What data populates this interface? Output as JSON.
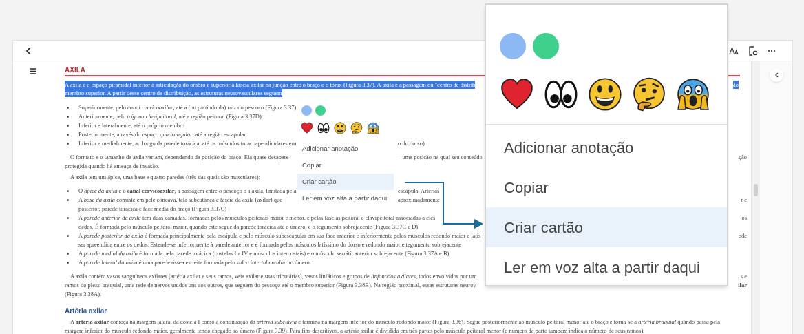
{
  "document": {
    "heading": "AXILA",
    "blocks": [
      {
        "kind": "highlight",
        "lines": [
          {
            "text": "A axila é o espaço piramidal inferior à articulação do ombro e superior à fáscia axilar na junção entre o braço e o tórax (Figura 3.37). A axila é a passagem ou \"centro de distrib",
            "edge": "ão"
          },
          {
            "text": "membro superior. A partir desse centro de distribuição, as estruturas neurovasculares seguem"
          }
        ]
      },
      {
        "kind": "bullets",
        "items": [
          {
            "lines": [
              {
                "text": "Superiormente, pelo *canal cervicoaxilar*, até a (ou partindo da) raiz do pescoço (Figura 3.37)"
              }
            ]
          },
          {
            "lines": [
              {
                "text": "Anteriormente, pelo *trígono clavipeitoral*, até a região peitoral (Figura 3.37D)"
              }
            ]
          },
          {
            "lines": [
              {
                "text": "Inferior e lateralmente, até o próprio membro"
              }
            ]
          },
          {
            "lines": [
              {
                "text": "Posteriormente, através do *espaço quadrangular*, até a região escapular"
              }
            ]
          },
          {
            "lines": [
              {
                "text": "Inferior e medialmente, ao longo da parede torácica, até os músculos toracoapendiculares em",
                "after_menu": "o do dorso)"
              }
            ]
          }
        ]
      },
      {
        "kind": "paragraph",
        "lines": [
          {
            "text": "O formato e o tamanho da axila variam, dependendo da posição do braço. Ela quase desapare",
            "after_menu": "– uma posição na qual seu conteúdo",
            "edge": "ção"
          },
          {
            "text": "protegida quando há ameaça de invasão."
          }
        ]
      },
      {
        "kind": "paragraph",
        "lines": [
          {
            "text": "A axila tem um ápice, uma base e quatro paredes (três das quais são musculares):"
          }
        ]
      },
      {
        "kind": "bullets",
        "items": [
          {
            "lines": [
              {
                "text": "O *ápice da axila* é o **canal cervicoaxilar**, a passagem entre o pescoço e a axila, limitada pela",
                "after_menu": "escápula. Artérias"
              }
            ]
          },
          {
            "lines": [
              {
                "text": "A *base da axila* consiste em pele côncava, tela subcutânea e fáscia da axila (axilar) que",
                "after_menu": "aproximadamente",
                "edge": "r e"
              },
              {
                "text": "posterior, parede torácica e face média do braço (Figura 3.37C)"
              }
            ]
          },
          {
            "lines": [
              {
                "text": "A *parede anterior da axila* tem duas camadas, formadas pelos músculos peitorais maior e menor, e pelas fáscias peitoral e clavipeitoral associadas a eles",
                "edge": "os"
              },
              {
                "text": "dedos. É formada pelo músculo peitoral maior, quando este segue da parede torácica até o úmero, e o tegumento sobrejacente (Figura 3.37C e D)"
              }
            ]
          },
          {
            "lines": [
              {
                "text": "A *parede posterior da axila* é formada principalmente pela escápula e pelo músculo subescapular em sua face anterior e inferiormente pelos músculos redondo maior e latís",
                "edge": "ode"
              },
              {
                "text": "ser apreendida entre os dedos. Estende-se inferiormente à parede anterior e é formada pelos músculos latíssimo do dorso e redondo maior e tegumento sobrejacente"
              }
            ]
          },
          {
            "lines": [
              {
                "text": "A *parede medial da axila* é formada pela parede torácica (costelas I a IV e músculos intercostais) e o músculo serrátil anterior sobrejacente (Figura 3.37A e B)"
              }
            ]
          },
          {
            "lines": [
              {
                "text": "A *parede lateral da axila* é uma parede óssea estreita formada pelo *sulco intertubercular* no úmero."
              }
            ]
          }
        ]
      },
      {
        "kind": "paragraph",
        "lines": [
          {
            "text": "A axila contém vasos sanguíneos axilares (artéria axilar e seus ramos, veia axilar e suas tributárias), vasos linfáticos e grupos de *linfonodos axilares*, todos envolvidos por um",
            "edge": "s e"
          },
          {
            "text": "ramos do plexo braquial, uma rede de nervos unidos uns aos outros, que seguem do pescoço até o membro superior (Figura 3.38B). Na região proximal, essas estruturas neurov",
            "edge": "**ilar**"
          },
          {
            "text": "(Figura 3.38A)."
          }
        ]
      },
      {
        "kind": "subheading",
        "text": "Artéria axilar"
      },
      {
        "kind": "paragraph",
        "lines": [
          {
            "text": "A **artéria axilar** começa na margem lateral da costela I como a continuação da *artéria subclávia* e termina na margem inferior do músculo redondo maior (Figura 3.36). Segue posteriormente ao músculo peitoral menor até o braço e torna-se a *artéria braquial* quando passa pela"
          },
          {
            "text": "margem inferior do músculo redondo maior, geralmente tendo chegado ao úmero (Figura 3.39). Para fins descritivos, a artéria axilar é dividida em três partes pelo músculo peitoral menor (o número da parte também indica o número de seus ramos)."
          }
        ]
      }
    ]
  },
  "context_menu": {
    "colors": [
      {
        "color": "#8cb8f4"
      },
      {
        "color": "#3fd08e"
      }
    ],
    "reactions": [
      {
        "kind": "heart"
      },
      {
        "kind": "eyes"
      },
      {
        "kind": "grin"
      },
      {
        "kind": "thinking"
      },
      {
        "kind": "scream"
      }
    ],
    "items": [
      {
        "label": "Adicionar anotação",
        "selected": false
      },
      {
        "label": "Copiar",
        "selected": false
      },
      {
        "label": "Criar cartão",
        "selected": true
      },
      {
        "label": "Ler em voz alta a partir daqui",
        "selected": false
      }
    ]
  },
  "zoom_callout": {
    "colors": [
      {
        "color": "#8cb8f4"
      },
      {
        "color": "#3fd08e"
      }
    ],
    "reactions": [
      {
        "kind": "heart"
      },
      {
        "kind": "eyes"
      },
      {
        "kind": "grin"
      },
      {
        "kind": "thinking"
      },
      {
        "kind": "scream"
      }
    ],
    "items": [
      {
        "label": "Adicionar anotação",
        "selected": false
      },
      {
        "label": "Copiar",
        "selected": false
      },
      {
        "label": "Criar cartão",
        "selected": true
      },
      {
        "label": "Ler em voz alta a partir daqui",
        "selected": false
      }
    ]
  }
}
